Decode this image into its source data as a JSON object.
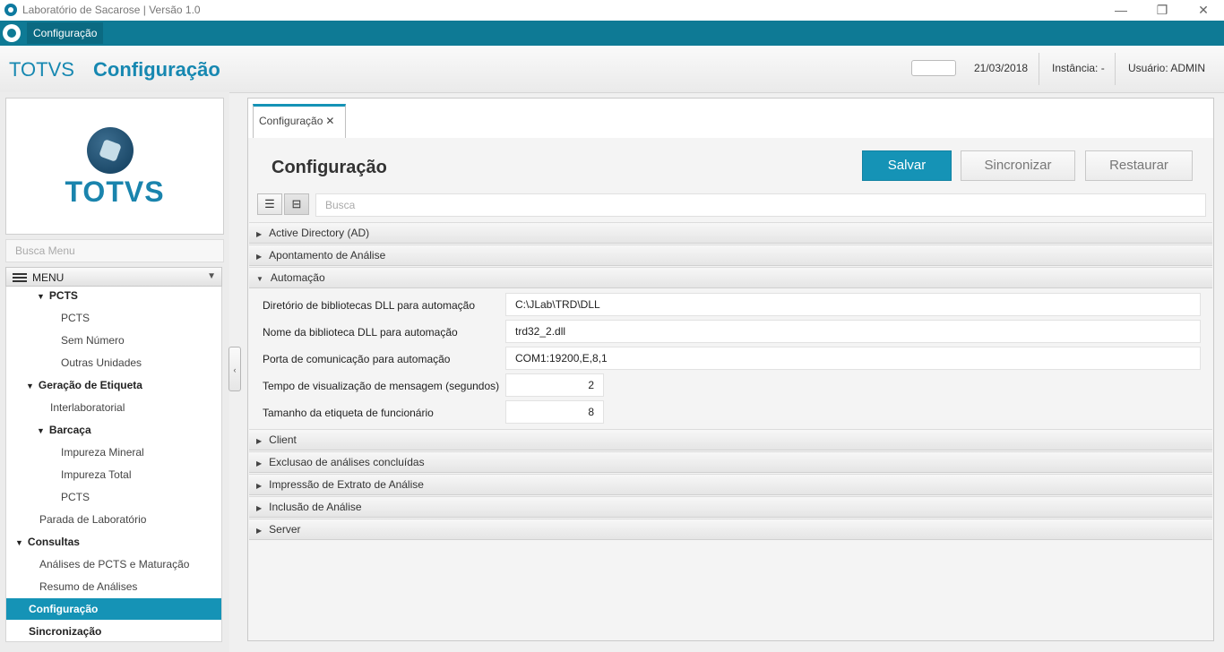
{
  "window": {
    "title": "Laboratório de Sacarose | Versão 1.0"
  },
  "menubar": {
    "item": "Configuração"
  },
  "header": {
    "brand": "TOTVS",
    "page": "Configuração",
    "date": "21/03/2018",
    "instancia": "Instância: -",
    "usuario": "Usuário: ADMIN"
  },
  "sidebar": {
    "logo_text": "TOTVS",
    "search_placeholder": "Busca Menu",
    "menu_label": "MENU",
    "items": [
      {
        "label": "PCTS",
        "level": 2,
        "expanded": true,
        "bold": true
      },
      {
        "label": "PCTS",
        "level": 3
      },
      {
        "label": "Sem Número",
        "level": 3
      },
      {
        "label": "Outras Unidades",
        "level": 3
      },
      {
        "label": "Geração de Etiqueta",
        "level": 1,
        "expanded": true,
        "bold": true
      },
      {
        "label": "Interlaboratorial",
        "level": 2
      },
      {
        "label": "Barcaça",
        "level": 2,
        "expanded": true,
        "bold": true
      },
      {
        "label": "Impureza Mineral",
        "level": 3
      },
      {
        "label": "Impureza Total",
        "level": 3
      },
      {
        "label": "PCTS",
        "level": 3
      },
      {
        "label": "Parada de Laboratório",
        "level": 1
      },
      {
        "label": "Consultas",
        "level": 0,
        "expanded": true,
        "bold": true
      },
      {
        "label": "Análises de PCTS e Maturação",
        "level": 1
      },
      {
        "label": "Resumo de Análises",
        "level": 1
      },
      {
        "label": "Configuração",
        "level": 0,
        "active": true
      },
      {
        "label": "Sincronização",
        "level": 0,
        "bold": true
      }
    ]
  },
  "content": {
    "tab_label": "Configuração",
    "page_title": "Configuração",
    "buttons": {
      "save": "Salvar",
      "sync": "Sincronizar",
      "restore": "Restaurar"
    },
    "search_placeholder": "Busca",
    "sections": [
      {
        "label": "Active Directory (AD)",
        "expanded": false
      },
      {
        "label": "Apontamento de Análise",
        "expanded": false
      },
      {
        "label": "Automação",
        "expanded": true
      },
      {
        "label": "Client",
        "expanded": false
      },
      {
        "label": "Exclusao de análises concluídas",
        "expanded": false
      },
      {
        "label": "Impressão de Extrato de Análise",
        "expanded": false
      },
      {
        "label": "Inclusão de Análise",
        "expanded": false
      },
      {
        "label": "Server",
        "expanded": false
      }
    ],
    "fields": [
      {
        "label": "Diretório de bibliotecas DLL para automação",
        "value": "C:\\JLab\\TRD\\DLL"
      },
      {
        "label": "Nome da biblioteca DLL para automação",
        "value": "trd32_2.dll"
      },
      {
        "label": "Porta de comunicação para automação",
        "value": "COM1:19200,E,8,1"
      },
      {
        "label": "Tempo de visualização de mensagem (segundos)",
        "value": "2"
      },
      {
        "label": "Tamanho da etiqueta de funcionário",
        "value": "8"
      }
    ]
  },
  "icons": {
    "expanded": "▼",
    "collapsed": "▶",
    "tab_close": "✕",
    "collapse_sidebar": "‹",
    "minimize": "—",
    "restore": "❐",
    "close": "✕",
    "dropdown": "▼",
    "list_view": "☰",
    "tree_view": "⊟"
  },
  "colors": {
    "brand": "#1593b6",
    "menubar": "#0e7a95",
    "active_item": "#1593b6"
  }
}
